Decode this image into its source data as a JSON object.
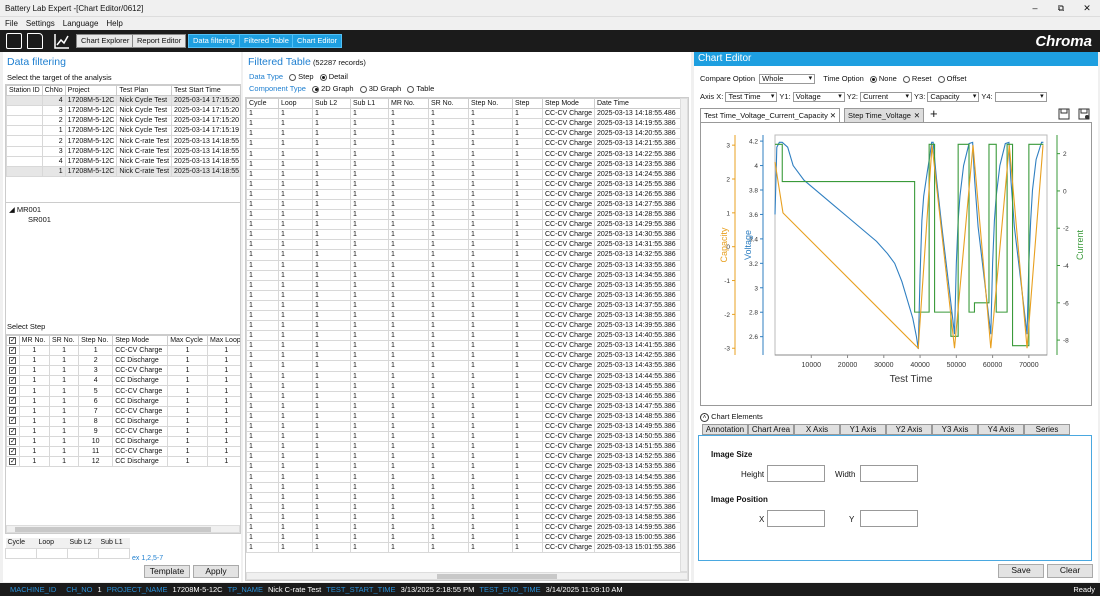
{
  "window": {
    "title": "Battery Lab Expert -[Chart Editor/0612]",
    "min": "–",
    "max": "⧉",
    "close": "✕"
  },
  "menu": [
    "File",
    "Settings",
    "Language",
    "Help"
  ],
  "toolbar": {
    "explorer": "Chart Explorer",
    "report": "Report Editor",
    "filtering": "Data filtering",
    "ftable": "Filtered Table",
    "editor": "Chart Editor",
    "brand": "Chroma"
  },
  "left": {
    "title": "Data filtering",
    "subtitle": "Select the target of the analysis",
    "station_headers": [
      "Station ID",
      "ChNo",
      "Project",
      "Test Plan",
      "Test Start Time"
    ],
    "station_rows": [
      [
        "",
        "4",
        "17208M-5-12C",
        "Nick Cycle Test",
        "2025-03-14 17:15:20"
      ],
      [
        "",
        "3",
        "17208M-5-12C",
        "Nick Cycle Test",
        "2025-03-14 17:15:20"
      ],
      [
        "",
        "2",
        "17208M-5-12C",
        "Nick Cycle Test",
        "2025-03-14 17:15:20"
      ],
      [
        "",
        "1",
        "17208M-5-12C",
        "Nick Cycle Test",
        "2025-03-14 17:15:19"
      ],
      [
        "",
        "2",
        "17208M-5-12C",
        "Nick C-rate Test",
        "2025-03-13 14:18:55"
      ],
      [
        "",
        "3",
        "17208M-5-12C",
        "Nick C-rate Test",
        "2025-03-13 14:18:55"
      ],
      [
        "",
        "4",
        "17208M-5-12C",
        "Nick C-rate Test",
        "2025-03-13 14:18:55"
      ],
      [
        "",
        "1",
        "17208M-5-12C",
        "Nick C-rate Test",
        "2025-03-13 14:18:55"
      ]
    ],
    "tree_root": "MR001",
    "tree_child": "SR001",
    "select_step": "Select Step",
    "step_headers": [
      "MR No.",
      "SR No.",
      "Step No.",
      "Step Mode",
      "Max Cycle",
      "Max Loop",
      "E"
    ],
    "step_rows": [
      [
        "1",
        "1",
        "1",
        "CC-CV Charge",
        "1",
        "1"
      ],
      [
        "1",
        "1",
        "2",
        "CC Discharge",
        "1",
        "1"
      ],
      [
        "1",
        "1",
        "3",
        "CC-CV Charge",
        "1",
        "1"
      ],
      [
        "1",
        "1",
        "4",
        "CC Discharge",
        "1",
        "1"
      ],
      [
        "1",
        "1",
        "5",
        "CC-CV Charge",
        "1",
        "1"
      ],
      [
        "1",
        "1",
        "6",
        "CC Discharge",
        "1",
        "1"
      ],
      [
        "1",
        "1",
        "7",
        "CC-CV Charge",
        "1",
        "1"
      ],
      [
        "1",
        "1",
        "8",
        "CC Discharge",
        "1",
        "1"
      ],
      [
        "1",
        "1",
        "9",
        "CC-CV Charge",
        "1",
        "1"
      ],
      [
        "1",
        "1",
        "10",
        "CC Discharge",
        "1",
        "1"
      ],
      [
        "1",
        "1",
        "11",
        "CC-CV Charge",
        "1",
        "1"
      ],
      [
        "1",
        "1",
        "12",
        "CC Discharge",
        "1",
        "1"
      ]
    ],
    "filter_headers": [
      "Cycle",
      "Loop",
      "Sub L2",
      "Sub L1"
    ],
    "example": "ex 1,2,5-7",
    "template": "Template",
    "apply": "Apply"
  },
  "middle": {
    "title": "Filtered Table",
    "records": "(52287 records)",
    "data_type": "Data Type",
    "dt_step": "Step",
    "dt_detail": "Detail",
    "comp_type": "Component Type",
    "ct_2d": "2D Graph",
    "ct_3d": "3D Graph",
    "ct_table": "Table",
    "headers": [
      "Cycle",
      "Loop",
      "Sub L2",
      "Sub L1",
      "MR No.",
      "SR No.",
      "Step No.",
      "Step",
      "Step Mode",
      "Date Time"
    ],
    "row_count": 44,
    "first_time": "2025-03-13 14:18:55.486",
    "mode": "CC-CV Charge"
  },
  "right": {
    "title": "Chart Editor",
    "compare_label": "Compare Option",
    "compare_val": "Whole",
    "time_label": "Time Option",
    "time_none": "None",
    "time_reset": "Reset",
    "time_offset": "Offset",
    "axisx_label": "Axis X:",
    "axisx": "Test Time",
    "y1_label": "Y1:",
    "y1": "Voltage",
    "y2_label": "Y2:",
    "y2": "Current",
    "y3_label": "Y3:",
    "y3": "Capacity",
    "y4_label": "Y4:",
    "y4": "",
    "tab1": "Test Time_Voltage_Current_Capacity",
    "tab2": "Step Time_Voltage",
    "plus": "+",
    "elements": "Chart Elements",
    "element_tabs": [
      "Annotation",
      "Chart Area",
      "X Axis",
      "Y1 Axis",
      "Y2 Axis",
      "Y3 Axis",
      "Y4 Axis",
      "Series"
    ],
    "image_size": "Image Size",
    "height": "Height",
    "width": "Width",
    "image_pos": "Image Position",
    "x": "X",
    "y": "Y",
    "save": "Save",
    "clear": "Clear"
  },
  "chart_data": {
    "type": "line",
    "xlabel": "Test Time",
    "xticks": [
      10000,
      20000,
      30000,
      40000,
      50000,
      60000,
      70000
    ],
    "xlim": [
      0,
      75000
    ],
    "axes": [
      {
        "name": "Voltage",
        "side": "left-inner",
        "color": "#2f7fc1",
        "ticks": [
          2.6,
          2.8,
          3,
          3.2,
          3.4,
          3.6,
          3.8,
          4,
          4.2
        ],
        "lim": [
          2.45,
          4.25
        ]
      },
      {
        "name": "Capacity",
        "side": "left-outer",
        "color": "#e8a020",
        "ticks": [
          -3,
          -2,
          -1,
          0,
          1,
          2,
          3
        ],
        "lim": [
          -3.2,
          3.3
        ]
      },
      {
        "name": "Current",
        "side": "right",
        "color": "#3a9a3a",
        "ticks": [
          -8,
          -6,
          -4,
          -2,
          0,
          2
        ],
        "lim": [
          -8.8,
          3.0
        ]
      }
    ],
    "series": [
      {
        "name": "Voltage",
        "axis": 0,
        "x": [
          0,
          500,
          1200,
          2000,
          3500,
          5000,
          8000,
          12000,
          16000,
          20000,
          24000,
          28000,
          31000,
          33000,
          35000,
          36500,
          38000,
          39000,
          39500,
          40000,
          40500,
          41000,
          42000,
          42800,
          43200,
          43600,
          44500,
          46000,
          48000,
          49500,
          50000,
          50500,
          51000,
          52000,
          53500,
          54500,
          55000,
          56000,
          58000,
          59500,
          60000,
          60500,
          61000,
          62000,
          63500,
          64500,
          65000,
          66000,
          68000,
          69500,
          70000,
          70500,
          71000,
          72000,
          73500,
          74000
        ],
        "y": [
          3.6,
          4.15,
          4.19,
          4.19,
          4.15,
          4.0,
          3.88,
          3.78,
          3.68,
          3.58,
          3.48,
          3.38,
          3.28,
          3.2,
          3.05,
          2.9,
          2.75,
          2.6,
          2.5,
          3.1,
          3.55,
          3.75,
          3.95,
          4.1,
          4.19,
          4.19,
          3.9,
          3.5,
          3.0,
          2.62,
          3.2,
          3.55,
          3.75,
          4.0,
          4.18,
          4.19,
          3.9,
          3.5,
          3.0,
          2.62,
          3.2,
          3.55,
          3.75,
          4.0,
          4.18,
          4.19,
          3.9,
          3.5,
          3.0,
          2.62,
          3.2,
          3.55,
          3.8,
          4.05,
          4.19,
          4.19
        ]
      },
      {
        "name": "Current",
        "axis": 2,
        "x": [
          0,
          2000,
          2001,
          38500,
          38501,
          42500,
          42501,
          44000,
          44001,
          48500,
          48501,
          50500,
          50501,
          53500,
          53501,
          55000,
          55001,
          59000,
          59001,
          61000,
          61001,
          64000,
          64001,
          65500,
          65501,
          70000,
          70001,
          71500,
          71502,
          74000
        ],
        "y": [
          2.5,
          2.5,
          0.5,
          0.5,
          -6.5,
          -6.5,
          2.5,
          2.5,
          -6.5,
          -6.5,
          -7.8,
          -7.8,
          2.5,
          2.5,
          -6.5,
          -6.5,
          -6.0,
          -6.0,
          2.5,
          2.5,
          -6.5,
          -6.5,
          2.5,
          2.5,
          -8.3,
          -8.3,
          2.5,
          2.5,
          2.5,
          2.5
        ]
      },
      {
        "name": "Capacity",
        "axis": 1,
        "x": [
          0,
          2200,
          39500,
          43300,
          49500,
          54600,
          59500,
          64600,
          69500,
          73900
        ],
        "y": [
          2.5,
          1.0,
          -3.0,
          3.0,
          -3.0,
          3.0,
          -3.0,
          3.0,
          -3.0,
          3.0
        ]
      }
    ]
  },
  "status": [
    [
      "MACHINE_ID",
      ""
    ],
    [
      "CH_NO",
      "1"
    ],
    [
      "PROJECT_NAME",
      "17208M-5-12C"
    ],
    [
      "TP_NAME",
      "Nick C-rate Test"
    ],
    [
      "TEST_START_TIME",
      "3/13/2025 2:18:55 PM"
    ],
    [
      "TEST_END_TIME",
      "3/14/2025 11:09:10 AM"
    ]
  ],
  "ready": "Ready"
}
